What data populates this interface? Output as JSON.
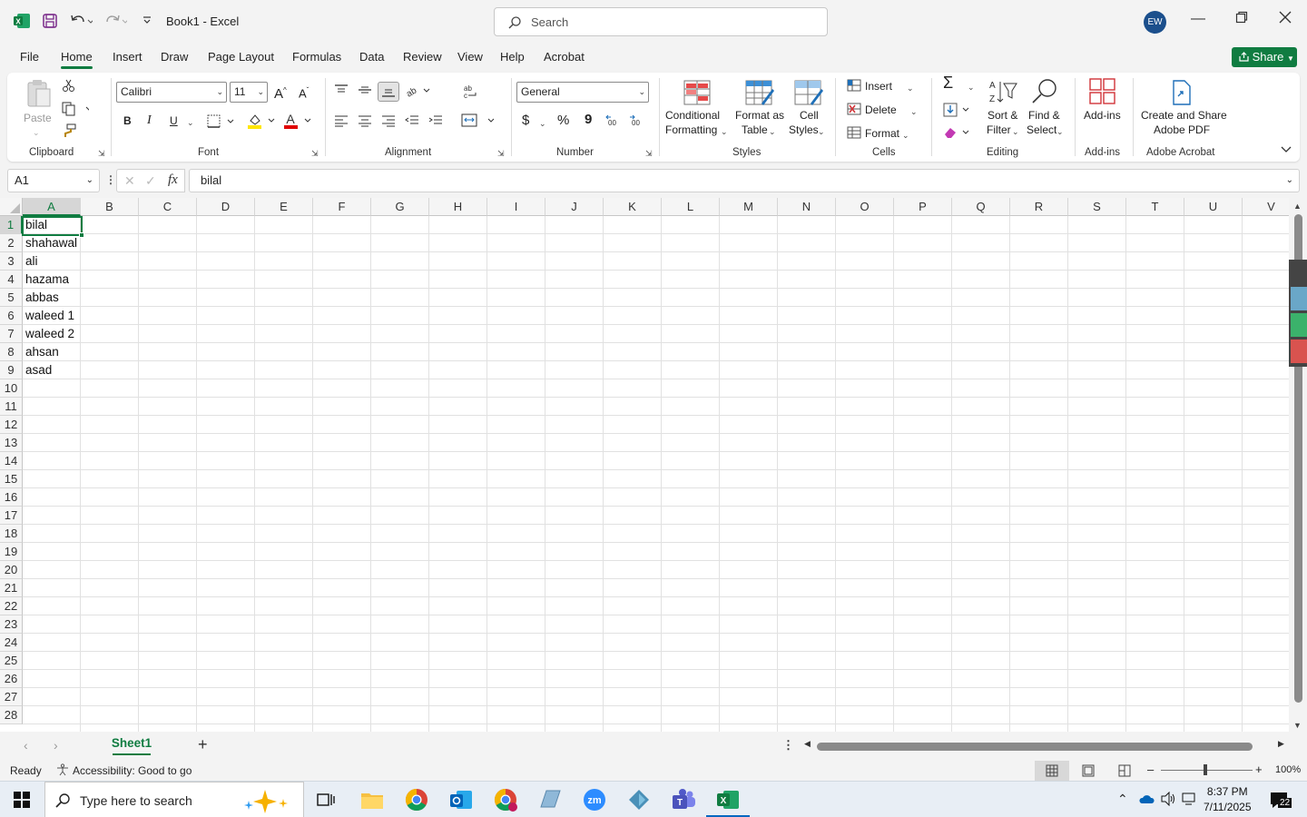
{
  "titlebar": {
    "doc_title": "Book1  -  Excel",
    "search_placeholder": "Search",
    "avatar_initials": "EW"
  },
  "menu_tabs": [
    "File",
    "Home",
    "Insert",
    "Draw",
    "Page Layout",
    "Formulas",
    "Data",
    "Review",
    "View",
    "Help",
    "Acrobat"
  ],
  "active_tab": "Home",
  "share_label": "Share",
  "ribbon": {
    "clipboard": {
      "paste": "Paste",
      "label": "Clipboard"
    },
    "font": {
      "name": "Calibri",
      "size": "11",
      "label": "Font",
      "bold": "B",
      "italic": "I",
      "underline": "U"
    },
    "alignment": {
      "label": "Alignment"
    },
    "number": {
      "format": "General",
      "label": "Number",
      "currency": "$",
      "percent": "%",
      "comma": "9"
    },
    "styles": {
      "cond_line1": "Conditional",
      "cond_line2": "Formatting",
      "table_line1": "Format as",
      "table_line2": "Table",
      "cell_line1": "Cell",
      "cell_line2": "Styles",
      "label": "Styles"
    },
    "cells": {
      "insert": "Insert",
      "delete": "Delete",
      "format": "Format",
      "label": "Cells"
    },
    "editing": {
      "sort_line1": "Sort &",
      "sort_line2": "Filter",
      "find_line1": "Find &",
      "find_line2": "Select",
      "label": "Editing"
    },
    "addins": {
      "button": "Add-ins",
      "label": "Add-ins"
    },
    "acrobat": {
      "line1": "Create and Share",
      "line2": "Adobe PDF",
      "label": "Adobe Acrobat"
    }
  },
  "formula_bar": {
    "name_box": "A1",
    "fx": "fx",
    "value": "bilal"
  },
  "columns": [
    "A",
    "B",
    "C",
    "D",
    "E",
    "F",
    "G",
    "H",
    "I",
    "J",
    "K",
    "L",
    "M",
    "N",
    "O",
    "P",
    "Q",
    "R",
    "S",
    "T",
    "U",
    "V"
  ],
  "rows": [
    "1",
    "2",
    "3",
    "4",
    "5",
    "6",
    "7",
    "8",
    "9",
    "10",
    "11",
    "12",
    "13",
    "14",
    "15",
    "16",
    "17",
    "18",
    "19",
    "20",
    "21",
    "22",
    "23",
    "24",
    "25",
    "26",
    "27",
    "28"
  ],
  "cells_A": [
    "bilal",
    "shahawal",
    "ali",
    "hazama",
    "abbas",
    "waleed 1",
    "waleed 2",
    "ahsan",
    "asad"
  ],
  "sheet_tab": "Sheet1",
  "status": {
    "ready": "Ready",
    "accessibility": "Accessibility: Good to go",
    "zoom": "100%"
  },
  "taskbar": {
    "search_placeholder": "Type here to search",
    "time": "8:37 PM",
    "date": "7/11/2025",
    "notifications": "22"
  },
  "colors": {
    "accent": "#107c41",
    "avatar": "#1b4f8c"
  }
}
